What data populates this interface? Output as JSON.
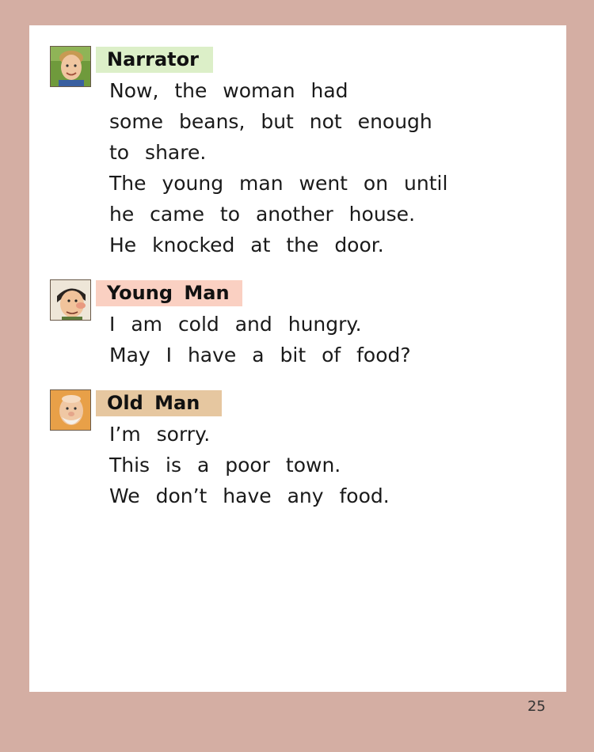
{
  "sections": [
    {
      "speaker": "Narrator",
      "name_bg": "#dcefc8",
      "avatar_icon": "boy-portrait-icon",
      "lines": [
        "Now, the woman had",
        "some beans, but not enough",
        "to share.",
        "The young man went on until",
        "he came to another house.",
        "He knocked at the door."
      ]
    },
    {
      "speaker": "Young Man",
      "name_bg": "#fad0c2",
      "avatar_icon": "young-man-portrait-icon",
      "lines": [
        "I am cold and hungry.",
        "May I have a bit of food?"
      ]
    },
    {
      "speaker": "Old Man",
      "name_bg": "#e6c7a0",
      "avatar_icon": "old-man-portrait-icon",
      "lines": [
        "I’m sorry.",
        "This is a poor town.",
        "We don’t have any food."
      ]
    }
  ],
  "page_number": "25"
}
